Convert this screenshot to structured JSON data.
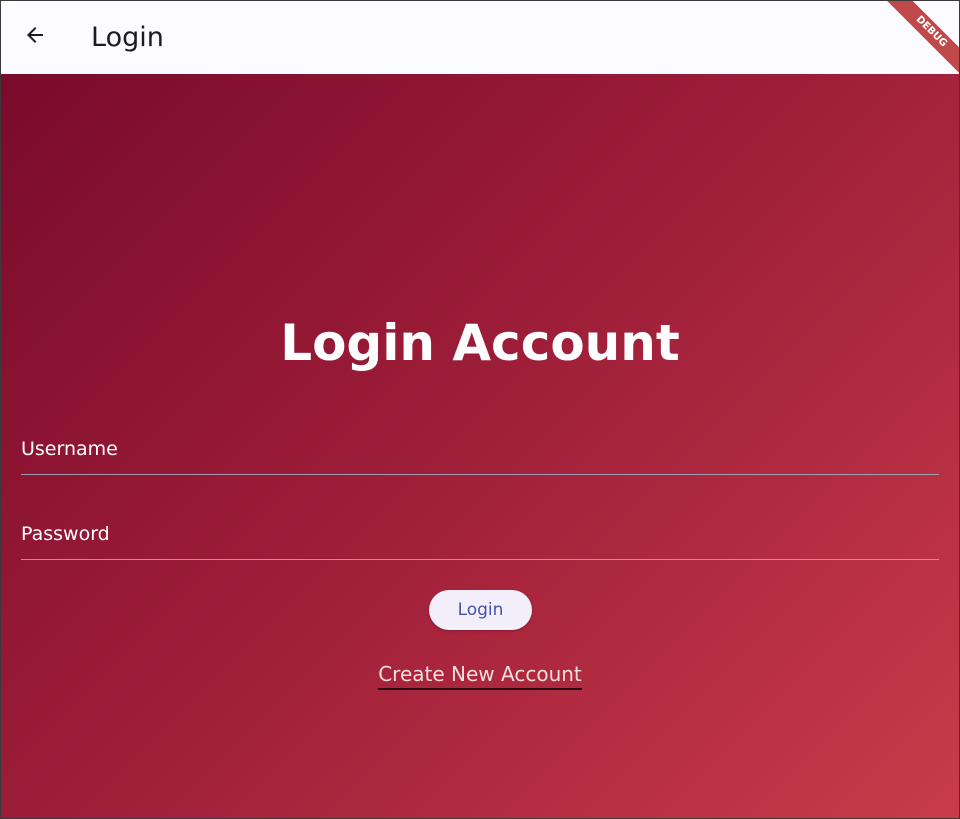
{
  "appbar": {
    "title": "Login",
    "back_icon": "arrow-back-icon"
  },
  "debug_banner": "DEBUG",
  "main": {
    "heading": "Login Account",
    "username_label": "Username",
    "password_label": "Password",
    "login_button": "Login",
    "create_account_link": "Create New Account"
  },
  "colors": {
    "gradient_start": "#7a0a2b",
    "gradient_end": "#c93b4a",
    "button_text": "#4452a8",
    "button_bg": "#f3effa"
  }
}
